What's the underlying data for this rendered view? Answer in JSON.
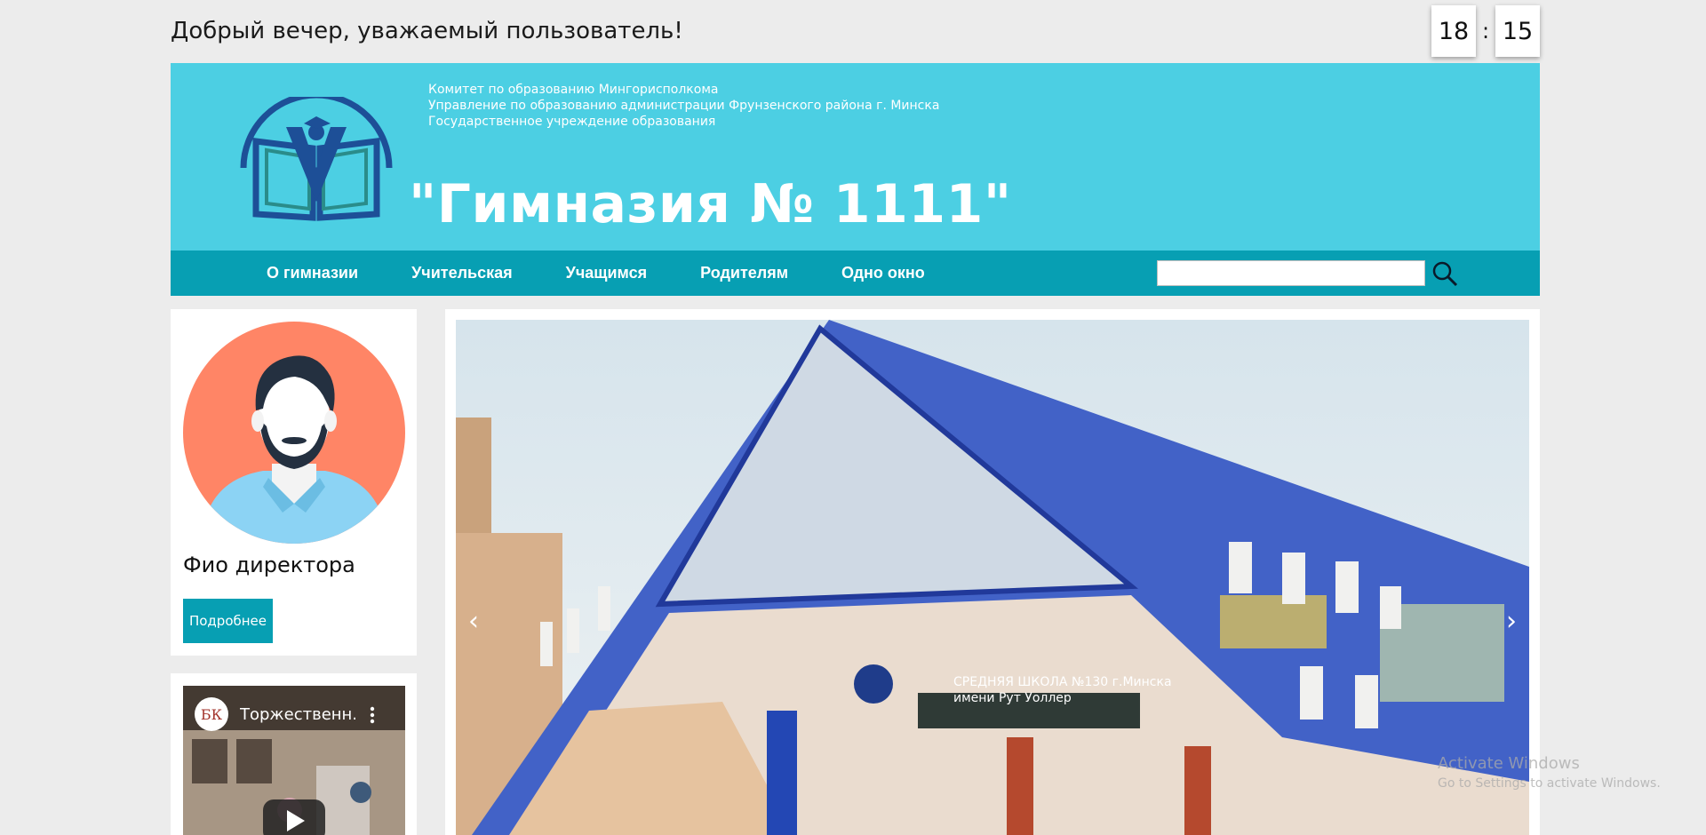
{
  "greeting": "Добрый вечер, уважаемый пользователь!",
  "clock": {
    "hours": "18",
    "separator": ":",
    "minutes": "15"
  },
  "header": {
    "lines": [
      "Комитет по образованию Мингорисполкома",
      "Управление по образованию администрации Фрунзенского района г. Минска",
      "Государственное учреждение образования"
    ],
    "title": "\"Гимназия № 1111\""
  },
  "nav": {
    "items": [
      "О гимназии",
      "Учительская",
      "Учащимся",
      "Родителям",
      "Одно окно"
    ],
    "search_placeholder": ""
  },
  "director": {
    "name": "Фио директора",
    "button_label": "Подробнее"
  },
  "video": {
    "title": "Торжественн...",
    "channel_logo": "БК"
  },
  "slider": {
    "sign_line1": "СРЕДНЯЯ ШКОЛА №130 г.Минска",
    "sign_line2": "имени Рут Уоллер",
    "prev": "‹",
    "next": "›"
  },
  "watermark": {
    "line1": "Activate Windows",
    "line2": "Go to Settings to activate Windows."
  },
  "colors": {
    "header_bg": "#4ccfe3",
    "nav_bg": "#079fb3",
    "accent": "#079fb3"
  }
}
